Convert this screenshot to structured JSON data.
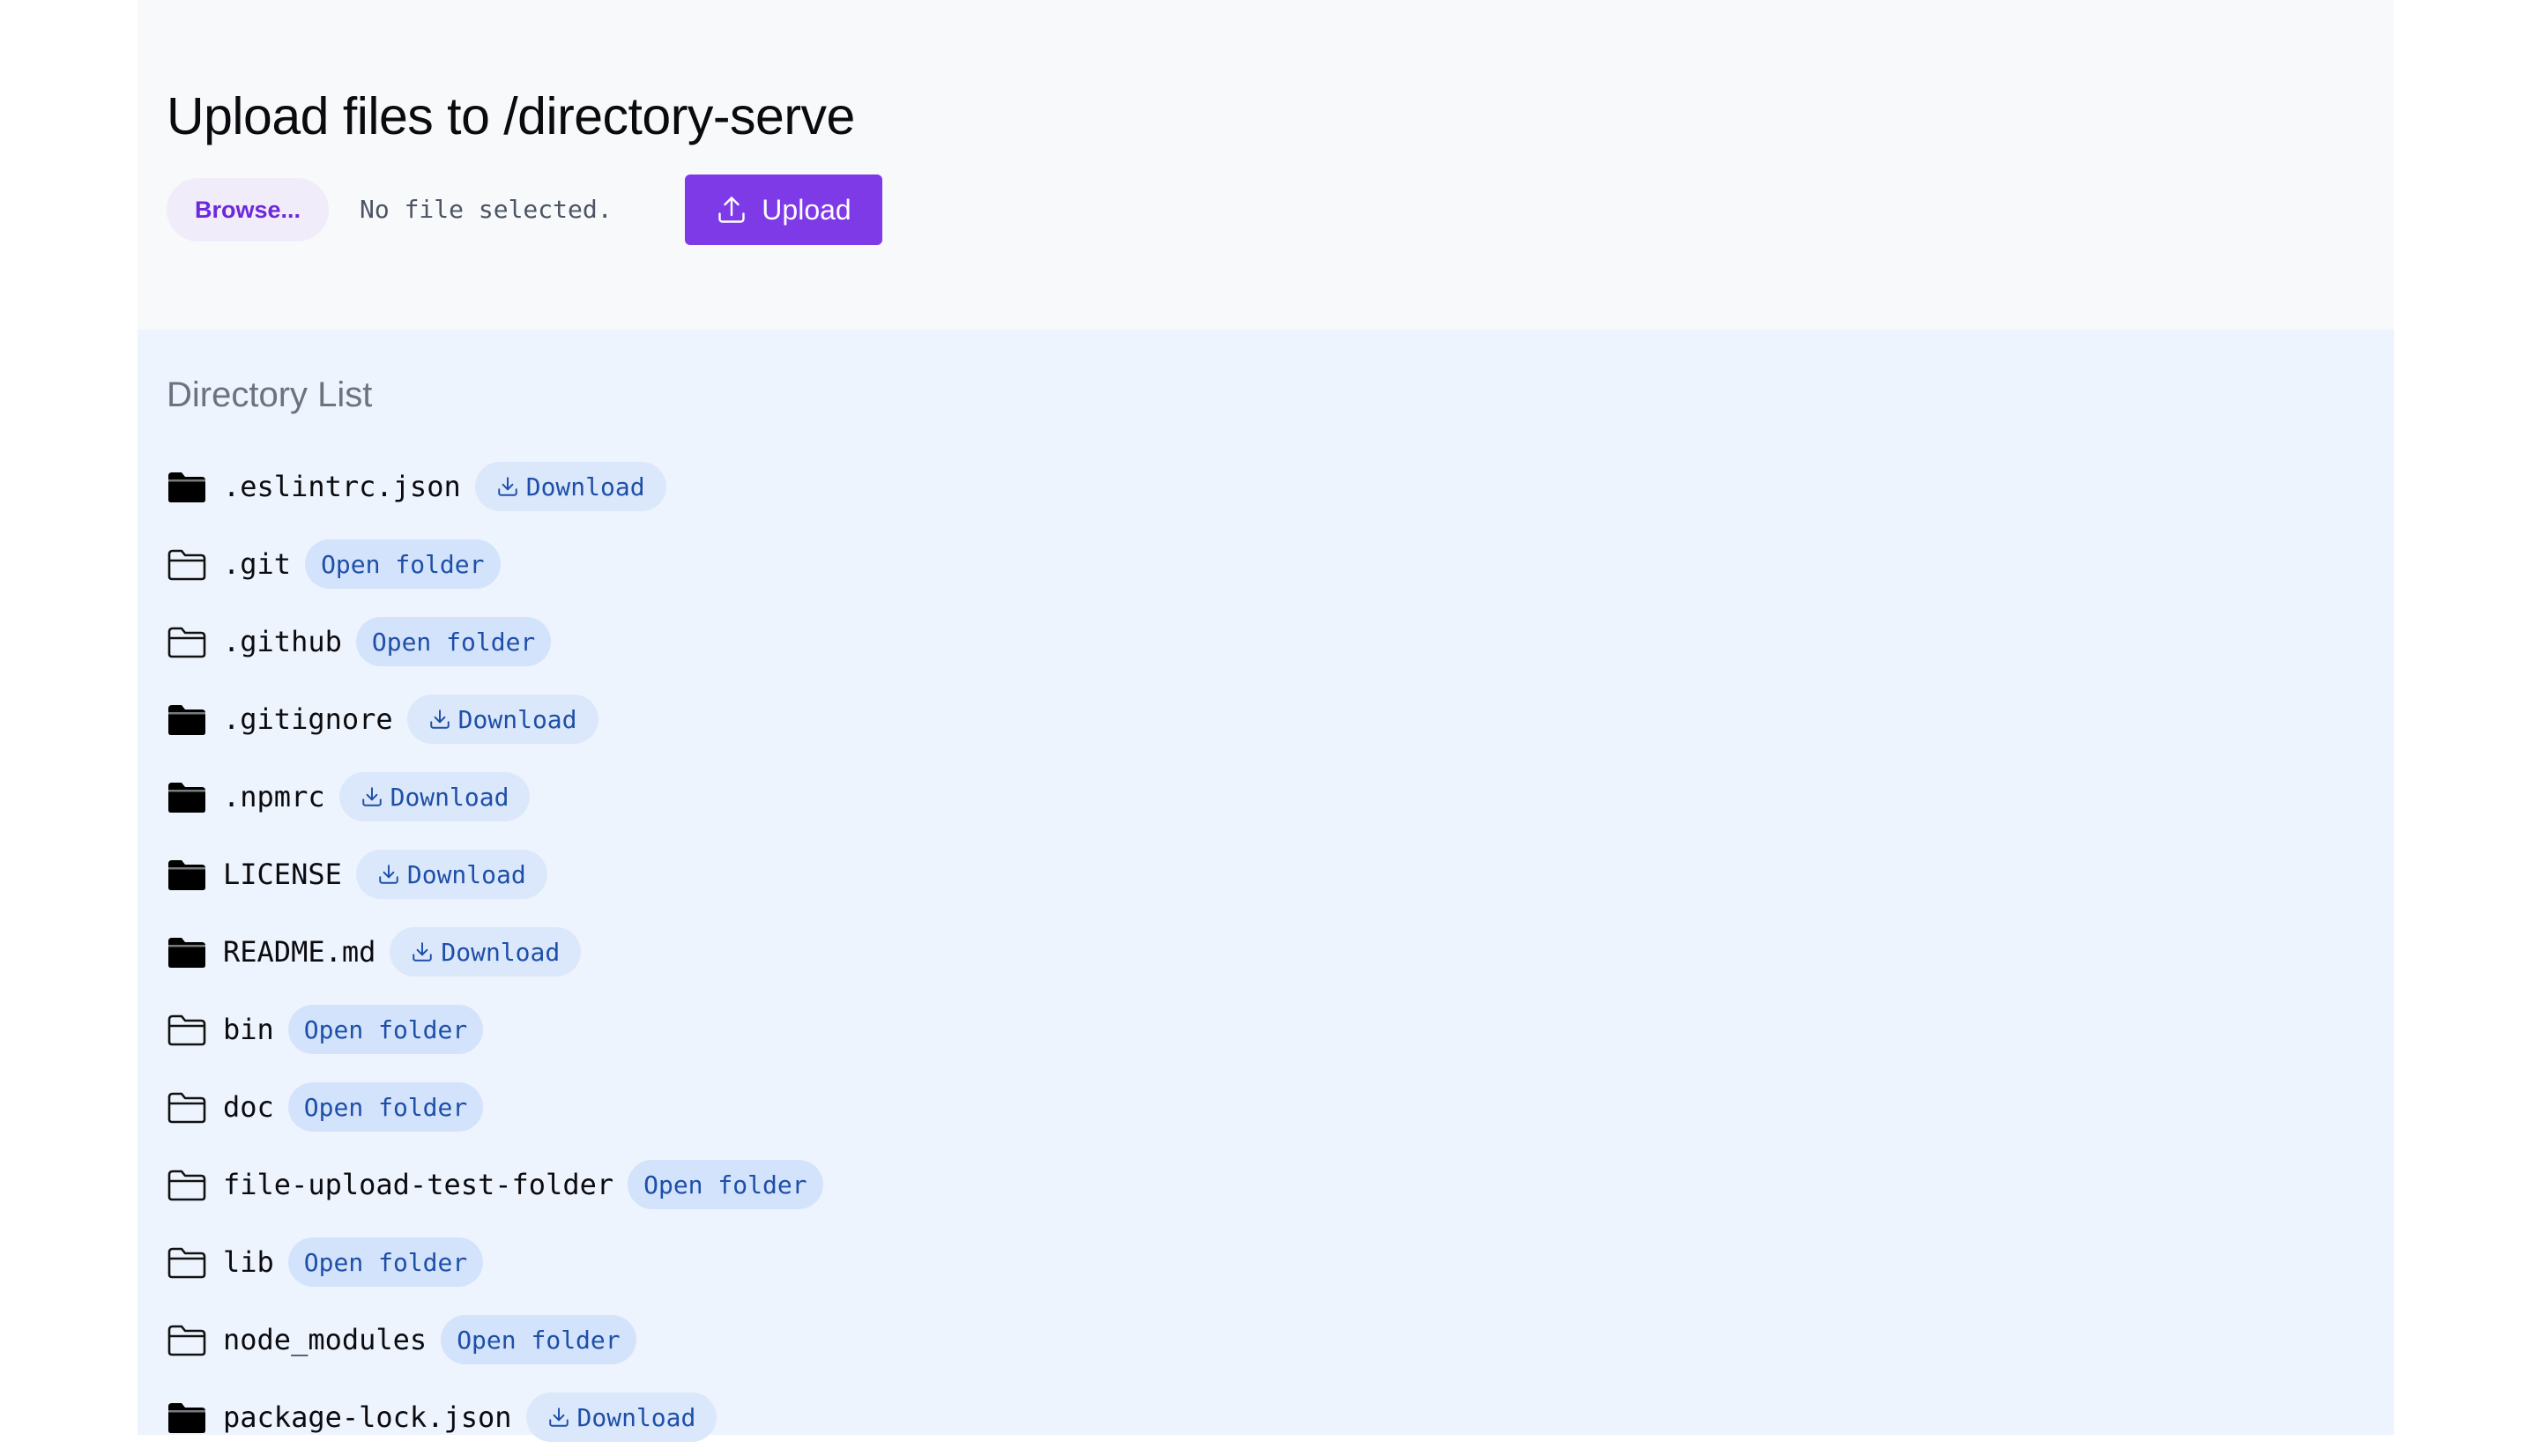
{
  "colors": {
    "accent": "#7e3ae6",
    "browse_text": "#6d28d9",
    "badge_bg": "#d3e3fb",
    "badge_text": "#1e4fa8",
    "list_bg": "#eef4fd"
  },
  "upload": {
    "title": "Upload files to /directory-serve",
    "browse_label": "Browse...",
    "file_status": "No file selected.",
    "upload_label": "Upload"
  },
  "directory": {
    "heading": "Directory List",
    "entries": [
      {
        "name": ".eslintrc.json",
        "kind": "file",
        "icon": "folder-filled-icon",
        "action": "Download"
      },
      {
        "name": ".git",
        "kind": "folder",
        "icon": "folder-outline-icon",
        "action": "Open folder"
      },
      {
        "name": ".github",
        "kind": "folder",
        "icon": "folder-outline-icon",
        "action": "Open folder"
      },
      {
        "name": ".gitignore",
        "kind": "file",
        "icon": "folder-filled-icon",
        "action": "Download"
      },
      {
        "name": ".npmrc",
        "kind": "file",
        "icon": "folder-filled-icon",
        "action": "Download"
      },
      {
        "name": "LICENSE",
        "kind": "file",
        "icon": "folder-filled-icon",
        "action": "Download"
      },
      {
        "name": "README.md",
        "kind": "file",
        "icon": "folder-filled-icon",
        "action": "Download"
      },
      {
        "name": "bin",
        "kind": "folder",
        "icon": "folder-outline-icon",
        "action": "Open folder"
      },
      {
        "name": "doc",
        "kind": "folder",
        "icon": "folder-outline-icon",
        "action": "Open folder"
      },
      {
        "name": "file-upload-test-folder",
        "kind": "folder",
        "icon": "folder-outline-icon",
        "action": "Open folder"
      },
      {
        "name": "lib",
        "kind": "folder",
        "icon": "folder-outline-icon",
        "action": "Open folder"
      },
      {
        "name": "node_modules",
        "kind": "folder",
        "icon": "folder-outline-icon",
        "action": "Open folder"
      },
      {
        "name": "package-lock.json",
        "kind": "file",
        "icon": "folder-filled-icon",
        "action": "Download"
      }
    ]
  }
}
